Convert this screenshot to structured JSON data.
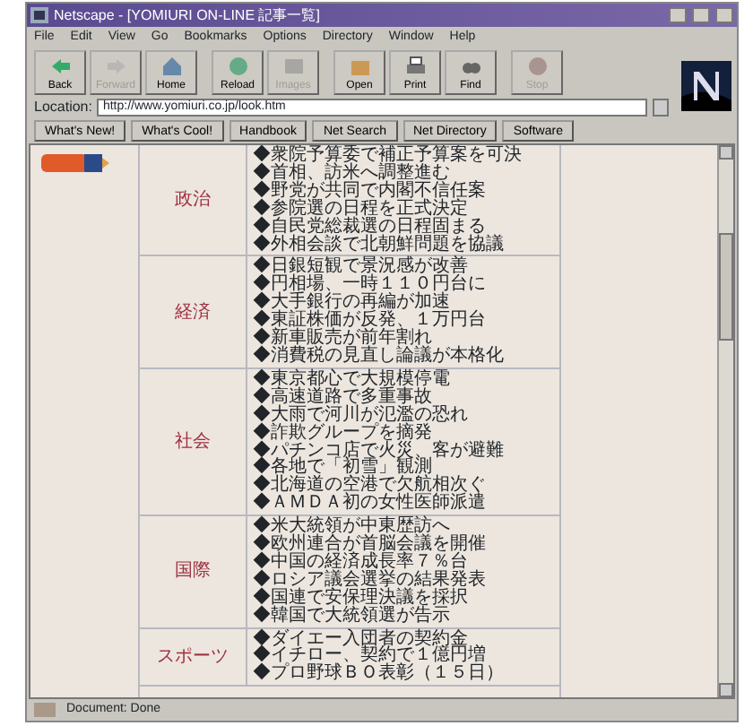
{
  "window": {
    "title": "Netscape - [YOMIURI ON-LINE 記事一覧]"
  },
  "menu": [
    "File",
    "Edit",
    "View",
    "Go",
    "Bookmarks",
    "Options",
    "Directory",
    "Window",
    "Help"
  ],
  "toolbar": [
    {
      "label": "Back",
      "disabled": false
    },
    {
      "label": "Forward",
      "disabled": true
    },
    {
      "label": "Home",
      "disabled": false
    },
    {
      "label": "Reload",
      "disabled": false
    },
    {
      "label": "Images",
      "disabled": true
    },
    {
      "label": "Open",
      "disabled": false
    },
    {
      "label": "Print",
      "disabled": false
    },
    {
      "label": "Find",
      "disabled": false
    },
    {
      "label": "Stop",
      "disabled": true
    }
  ],
  "location": {
    "label": "Location:",
    "url": "http://www.yomiuri.co.jp/look.htm"
  },
  "directory_buttons": [
    "What's New!",
    "What's Cool!",
    "Handbook",
    "Net Search",
    "Net Directory",
    "Software"
  ],
  "sections": [
    {
      "category": "政治",
      "headlines": [
        "◆衆院予算委で補正予算案を可決",
        "◆首相、訪米へ調整進む",
        "◆野党が共同で内閣不信任案",
        "◆参院選の日程を正式決定",
        "◆自民党総裁選の日程固まる",
        "◆外相会談で北朝鮮問題を協議"
      ]
    },
    {
      "category": "経済",
      "headlines": [
        "◆日銀短観で景況感が改善",
        "◆円相場、一時１１０円台に",
        "◆大手銀行の再編が加速",
        "◆東証株価が反発、１万円台",
        "◆新車販売が前年割れ",
        "◆消費税の見直し論議が本格化"
      ]
    },
    {
      "category": "社会",
      "headlines": [
        "◆東京都心で大規模停電",
        "◆高速道路で多重事故",
        "◆大雨で河川が氾濫の恐れ",
        "◆詐欺グループを摘発",
        "◆パチンコ店で火災、客が避難",
        "◆各地で「初雪」観測",
        "◆北海道の空港で欠航相次ぐ",
        "◆ＡＭＤＡ初の女性医師派遣"
      ]
    },
    {
      "category": "国際",
      "headlines": [
        "◆米大統領が中東歴訪へ",
        "◆欧州連合が首脳会議を開催",
        "◆中国の経済成長率７％台",
        "◆ロシア議会選挙の結果発表",
        "◆国連で安保理決議を採択",
        "◆韓国で大統領選が告示"
      ]
    },
    {
      "category": "スポーツ",
      "headlines": [
        "◆ダイエー入団者の契約金",
        "◆イチロー、契約で１億円増",
        "◆プロ野球ＢＯ表彰（１５日）"
      ]
    }
  ],
  "status_bar": {
    "text": "Document: Done"
  }
}
